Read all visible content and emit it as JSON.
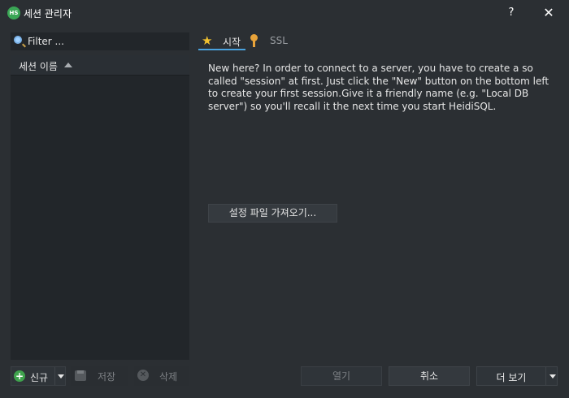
{
  "window": {
    "title": "세션 관리자",
    "app_icon_text": "HS",
    "help_label": "?",
    "close_label": "✕"
  },
  "filter": {
    "placeholder": "Filter ..."
  },
  "session_list": {
    "column_header": "세션 이름",
    "sort": "ascending",
    "items": []
  },
  "left_buttons": {
    "new_label": "신규",
    "save_label": "저장",
    "delete_label": "삭제"
  },
  "tabs": [
    {
      "label": "시작",
      "icon": "star-icon",
      "active": true
    },
    {
      "label": "SSL",
      "icon": "key-icon",
      "active": false
    }
  ],
  "start_tab": {
    "intro_text": "New here? In order to connect to a server, you have to create a so called \"session\" at first. Just click the \"New\" button on the bottom left to create your first session.Give it a friendly name (e.g. \"Local DB server\") so you'll recall it the next time you start HeidiSQL.",
    "import_button_label": "설정 파일 가져오기..."
  },
  "bottom_buttons": {
    "open_label": "열기",
    "cancel_label": "취소",
    "more_label": "더 보기"
  },
  "colors": {
    "background": "#2b2f33",
    "panel": "#22262a",
    "accent": "#4aa3df",
    "star": "#f2c230",
    "key": "#e8a33a",
    "new_icon": "#3fa34d"
  }
}
